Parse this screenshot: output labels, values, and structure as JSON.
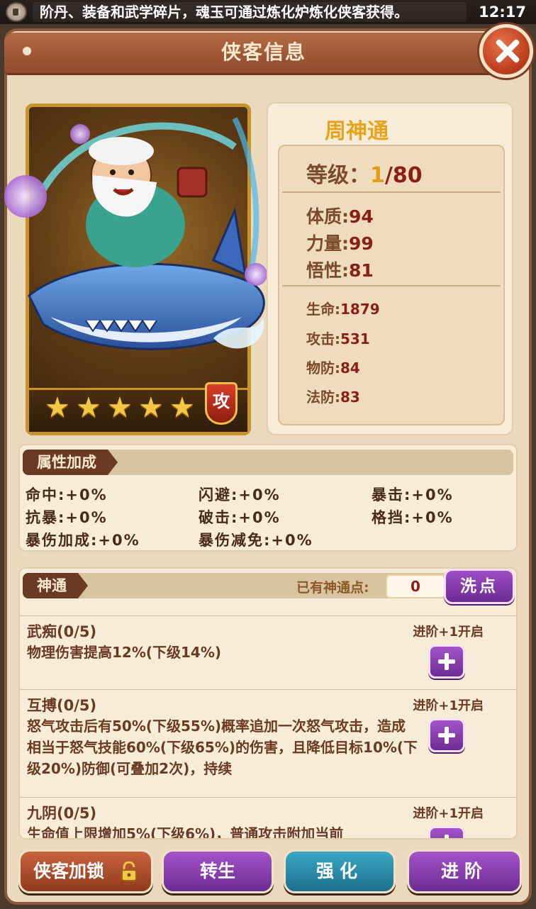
{
  "status_bar": {
    "marquee": "阶丹、装备和武学碎片，魂玉可通过炼化炉炼化侠客获得。",
    "time": "12:17"
  },
  "panel": {
    "title": "侠客信息"
  },
  "hero": {
    "name": "周神通",
    "stars": 5,
    "star_glyph": "★",
    "type_badge": "攻",
    "level_label": "等级：",
    "level_current": "1",
    "level_max": "/80",
    "attributes": [
      {
        "label": "体质:",
        "value": "94"
      },
      {
        "label": "力量:",
        "value": "99"
      },
      {
        "label": "悟性:",
        "value": "81"
      }
    ],
    "combat": [
      {
        "label": "生命:",
        "value": "1879"
      },
      {
        "label": "攻击:",
        "value": "531"
      },
      {
        "label": "物防:",
        "value": "84"
      },
      {
        "label": "法防:",
        "value": "83"
      }
    ]
  },
  "bonus": {
    "title": "属性加成",
    "items": [
      "命中:+0%",
      "闪避:+0%",
      "暴击:+0%",
      "抗暴:+0%",
      "破击:+0%",
      "格挡:+0%",
      "暴伤加成:+0%",
      "暴伤减免:+0%"
    ]
  },
  "skills": {
    "title": "神通",
    "points_label": "已有神通点:",
    "points_value": "0",
    "wash_label": "洗点",
    "list": [
      {
        "name": "武痴(0/5)",
        "unlock": "进阶+1开启",
        "desc": "物理伤害提高12%(下级14%)"
      },
      {
        "name": "互搏(0/5)",
        "unlock": "进阶+1开启",
        "desc": "怒气攻击后有50%(下级55%)概率追加一次怒气攻击，造成相当于怒气技能60%(下级65%)的伤害，且降低目标10%(下级20%)防御(可叠加2次)，持续"
      },
      {
        "name": "九阴(0/5)",
        "unlock": "进阶+1开启",
        "desc": "生命值上限增加5%(下级6%)，普通攻击附加当前"
      }
    ]
  },
  "buttons": {
    "lock": "侠客加锁",
    "reborn": "转生",
    "enhance": "强化",
    "advance": "进阶"
  }
}
